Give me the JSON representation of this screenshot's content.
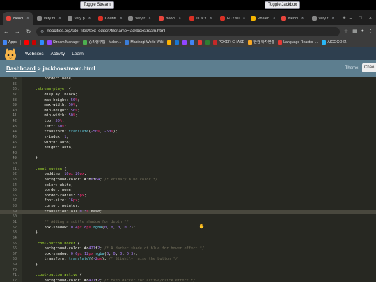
{
  "overlay": {
    "toggle_stream": "Toggle Stream",
    "toggle_jackbox": "Toggle Jackbox"
  },
  "tabs": [
    {
      "label": "Neoci",
      "color": "#e8453c",
      "active": true
    },
    {
      "label": "very ni",
      "color": "#888888"
    },
    {
      "label": "very p",
      "color": "#888888"
    },
    {
      "label": "Countr",
      "color": "#d93025"
    },
    {
      "label": "very r",
      "color": "#888888"
    },
    {
      "label": "neoci",
      "color": "#e8453c"
    },
    {
      "label": "Is a \"t",
      "color": "#d93025"
    },
    {
      "label": "FC2 su",
      "color": "#d93025"
    },
    {
      "label": "Phaleh",
      "color": "#f4b400"
    },
    {
      "label": "Neoci",
      "color": "#e8453c"
    },
    {
      "label": "very r",
      "color": "#888888"
    }
  ],
  "address": {
    "url": "neocities.org/site_files/text_editor?filename=jackboxstream.html"
  },
  "bookmarks": [
    {
      "label": "Apps",
      "color": "#4285f4"
    },
    {
      "label": "",
      "color": "#ff0000"
    },
    {
      "label": "",
      "color": "#cc0000"
    },
    {
      "label": "",
      "color": "#2f8cff"
    },
    {
      "label": "Stream Manager",
      "color": "#9146ff"
    },
    {
      "label": "중리랭쿠웹 - Mabin...",
      "color": "#4caf50"
    },
    {
      "label": "Mabinogi World Wiki",
      "color": "#3b7dd8"
    },
    {
      "label": "",
      "color": "#ffb300"
    },
    {
      "label": "",
      "color": "#1976d2"
    },
    {
      "label": "",
      "color": "#9146ff"
    },
    {
      "label": "",
      "color": "#4285f4"
    },
    {
      "label": "",
      "color": "#e53935"
    },
    {
      "label": "",
      "color": "#2e7d32"
    },
    {
      "label": "POKER CHASE",
      "color": "#c62828"
    },
    {
      "label": "한컴 타자연습",
      "color": "#f9a825"
    },
    {
      "label": "Language Reactor -...",
      "color": "#e53935"
    },
    {
      "label": "AIGOGO 보",
      "color": "#29b6f6"
    }
  ],
  "site_nav": {
    "websites": "Websites",
    "activity": "Activity",
    "learn": "Learn"
  },
  "breadcrumb": {
    "dashboard": "Dashboard",
    "separator": ">",
    "filename": "jackboxstream.html"
  },
  "theme": {
    "label": "Theme:",
    "value": "Chao"
  },
  "editor": {
    "current_line": 57,
    "lines": [
      {
        "n": 34,
        "code": "        border: none;"
      },
      {
        "n": 35,
        "code": ""
      },
      {
        "n": 36,
        "code": "    .stream-player {"
      },
      {
        "n": 37,
        "code": "        display: block;"
      },
      {
        "n": 38,
        "code": "        max-height: 50%;"
      },
      {
        "n": 39,
        "code": "        max-width: 50%;"
      },
      {
        "n": 40,
        "code": "        min-height: 50%;"
      },
      {
        "n": 41,
        "code": "        min-width: 50%;"
      },
      {
        "n": 42,
        "code": "        top: 50%;"
      },
      {
        "n": 43,
        "code": "        left: 50%;"
      },
      {
        "n": 44,
        "code": "        transform: translate(-50%, -50%);"
      },
      {
        "n": 45,
        "code": "        z-index: 1;"
      },
      {
        "n": 46,
        "code": "        width: auto;"
      },
      {
        "n": 47,
        "code": "        height: auto;"
      },
      {
        "n": 48,
        "code": ""
      },
      {
        "n": 49,
        "code": "    }"
      },
      {
        "n": 50,
        "code": ""
      },
      {
        "n": 51,
        "code": "    .cool-button {"
      },
      {
        "n": 52,
        "code": "        padding: 10px 20px;"
      },
      {
        "n": 53,
        "code": "        background-color: #3b6f64; /* Primary blue color */"
      },
      {
        "n": 54,
        "code": "        color: white;"
      },
      {
        "n": 55,
        "code": "        border: none;"
      },
      {
        "n": 56,
        "code": "        border-radius: 5px;"
      },
      {
        "n": 57,
        "code": "        font-size: 16px;"
      },
      {
        "n": 58,
        "code": "        cursor: pointer;"
      },
      {
        "n": 59,
        "code": "        transition: all 0.3s ease;"
      },
      {
        "n": 60,
        "code": ""
      },
      {
        "n": 61,
        "code": "        /* Adding a subtle shadow for depth */"
      },
      {
        "n": 62,
        "code": "        box-shadow: 0 4px 8px rgba(0, 0, 0, 0.2);"
      },
      {
        "n": 63,
        "code": "    }"
      },
      {
        "n": 64,
        "code": ""
      },
      {
        "n": 65,
        "code": "    .cool-button:hover {"
      },
      {
        "n": 66,
        "code": "        background-color: #c421f2; /* A darker shade of blue for hover effect */"
      },
      {
        "n": 67,
        "code": "        box-shadow: 0 6px 12px rgba(0, 0, 0, 0.3);"
      },
      {
        "n": 68,
        "code": "        transform: translateY(-2px); /* Slightly raise the button */"
      },
      {
        "n": 69,
        "code": "    }"
      },
      {
        "n": 70,
        "code": ""
      },
      {
        "n": 71,
        "code": "    .cool-button:active {"
      },
      {
        "n": 72,
        "code": "        background-color: #c421f2; /* Even darker for active/click effect */"
      },
      {
        "n": 73,
        "code": "        box-shadow: 0 2px 4px rgba(0, 0, 0, 0.2);"
      },
      {
        "n": 74,
        "code": "        transform: translateY(1px); /* Button presses down */"
      }
    ]
  }
}
